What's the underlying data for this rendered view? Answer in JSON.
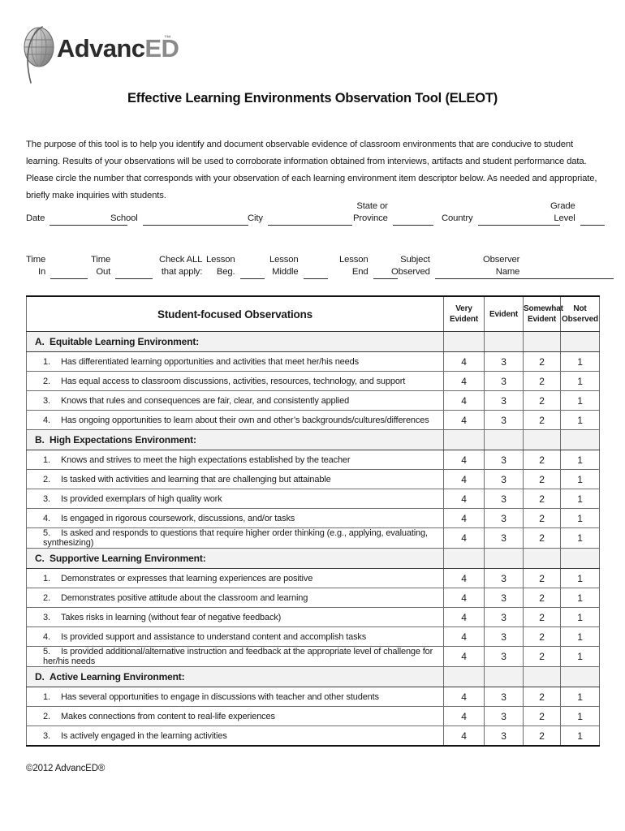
{
  "logo": {
    "icon": "advanced-globe-logo",
    "word_advanc": "Advanc",
    "word_ed": "ED",
    "trademark": "™"
  },
  "title": "Effective Learning Environments Observation Tool (ELEOT)",
  "intro": "The purpose of this tool is to help you identify and document observable evidence of classroom environments that are conducive to student learning. Results of your observations will be used to corroborate information obtained from interviews, artifacts and student performance data. Please circle the number that corresponds with your observation of each learning environment item descriptor below. As needed and appropriate, briefly make inquiries with students.",
  "form": {
    "row1": [
      {
        "label": "Date",
        "value": ""
      },
      {
        "label": "School",
        "value": ""
      },
      {
        "label": "City",
        "value": ""
      },
      {
        "label": "State or\nProvince",
        "value": ""
      },
      {
        "label": "Country",
        "value": ""
      },
      {
        "label": "Grade\nLevel",
        "value": ""
      }
    ],
    "row2": [
      {
        "label": "Time\nIn",
        "value": ""
      },
      {
        "label": "Time\nOut",
        "value": ""
      },
      {
        "label": "Check ALL\nthat apply:",
        "value": ""
      },
      {
        "label": "Lesson\nBeg.",
        "value": ""
      },
      {
        "label": "Lesson\nMiddle",
        "value": ""
      },
      {
        "label": "Lesson\nEnd",
        "value": ""
      },
      {
        "label": "Subject\nObserved",
        "value": ""
      },
      {
        "label": "Observer\nName",
        "value": ""
      }
    ]
  },
  "table": {
    "headers": {
      "main": "Student-focused Observations",
      "r1": "Very\nEvident",
      "r2": "Evident",
      "r3": "Somewhat\nEvident",
      "r4": "Not\nObserved"
    },
    "ratings": [
      "4",
      "3",
      "2",
      "1"
    ],
    "sections": [
      {
        "letter": "A.",
        "title": "Equitable Learning Environment:",
        "items": [
          {
            "num": "1.",
            "text": "Has differentiated learning opportunities and activities that meet her/his needs"
          },
          {
            "num": "2.",
            "text": "Has equal access to classroom discussions, activities, resources, technology, and support"
          },
          {
            "num": "3.",
            "text": "Knows that rules and consequences are fair, clear, and consistently applied"
          },
          {
            "num": "4.",
            "text": "Has ongoing opportunities to learn about their own and other’s backgrounds/cultures/differences"
          }
        ]
      },
      {
        "letter": "B.",
        "title": "High Expectations Environment:",
        "items": [
          {
            "num": "1.",
            "text": "Knows and strives to meet the high expectations established by the teacher"
          },
          {
            "num": "2.",
            "text": "Is tasked with activities and learning that are challenging but attainable"
          },
          {
            "num": "3.",
            "text": "Is provided exemplars of high quality work"
          },
          {
            "num": "4.",
            "text": "Is engaged in rigorous coursework, discussions, and/or tasks"
          },
          {
            "num": "5.",
            "text": "Is asked and responds to questions that require higher order thinking (e.g., applying, evaluating, synthesizing)"
          }
        ]
      },
      {
        "letter": "C.",
        "title": "Supportive Learning Environment:",
        "items": [
          {
            "num": "1.",
            "text": "Demonstrates or expresses that learning experiences are positive"
          },
          {
            "num": "2.",
            "text": "Demonstrates positive attitude about the classroom and learning"
          },
          {
            "num": "3.",
            "text": "Takes risks in learning (without fear of negative feedback)"
          },
          {
            "num": "4.",
            "text": "Is provided support and assistance to understand content and accomplish tasks"
          },
          {
            "num": "5.",
            "text": "Is provided additional/alternative instruction and feedback at the appropriate level of challenge for her/his needs"
          }
        ]
      },
      {
        "letter": "D.",
        "title": "Active Learning Environment:",
        "items": [
          {
            "num": "1.",
            "text": "Has several opportunities to engage in discussions with teacher and other students"
          },
          {
            "num": "2.",
            "text": "Makes connections from content to real-life experiences"
          },
          {
            "num": "3.",
            "text": "Is actively engaged in the learning activities"
          }
        ]
      }
    ]
  },
  "footer": "©2012 AdvancED®"
}
